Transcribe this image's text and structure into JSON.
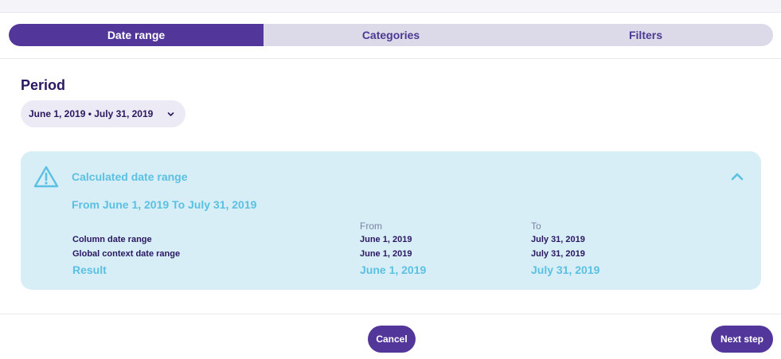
{
  "tabs": [
    {
      "label": "Date range",
      "active": true
    },
    {
      "label": "Categories",
      "active": false
    },
    {
      "label": "Filters",
      "active": false
    }
  ],
  "period": {
    "title": "Period",
    "selected": "June 1, 2019 • July 31, 2019",
    "icon": "chevron-down-icon"
  },
  "calc": {
    "title": "Calculated date range",
    "subtitle": "From June 1, 2019 To July 31, 2019",
    "icons": {
      "warning": "warning-triangle-icon",
      "collapse": "chevron-up-icon"
    },
    "columns": {
      "from": "From",
      "to": "To"
    },
    "rows": [
      {
        "label": "Column date range",
        "from": "June 1, 2019",
        "to": "July 31, 2019"
      },
      {
        "label": "Global context date range",
        "from": "June 1, 2019",
        "to": "July 31, 2019"
      }
    ],
    "result": {
      "label": "Result",
      "from": "June 1, 2019",
      "to": "July 31, 2019"
    }
  },
  "footer": {
    "cancel": "Cancel",
    "next": "Next step"
  },
  "colors": {
    "accent": "#523699",
    "info": "#5bc0e1",
    "infoBg": "#d7eef7"
  }
}
